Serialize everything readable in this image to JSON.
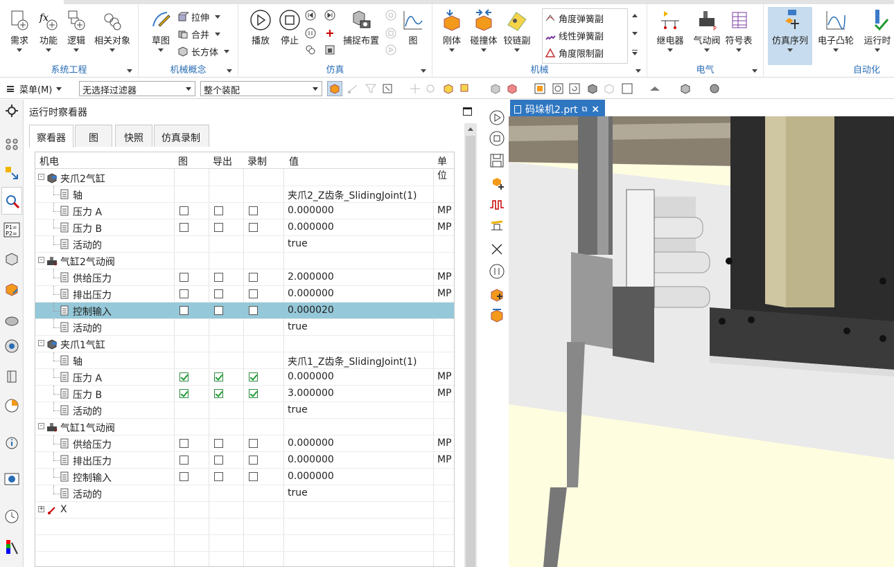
{
  "ribbon": {
    "groups": [
      {
        "label": "系统工程",
        "buttons": [
          "需求",
          "功能",
          "逻辑",
          "相关对象"
        ]
      },
      {
        "label": "机械概念",
        "big": "草图",
        "small": [
          "拉伸",
          "合并",
          "长方体"
        ]
      },
      {
        "label": "仿真",
        "buttons": [
          "播放",
          "停止",
          "捕捉布置",
          "图"
        ]
      },
      {
        "label": "机械",
        "buttons": [
          "刚体",
          "碰撞体",
          "铰链副"
        ],
        "small": [
          "角度弹簧副",
          "线性弹簧副",
          "角度限制副"
        ]
      },
      {
        "label": "电气",
        "buttons": [
          "继电器",
          "气动阀",
          "符号表"
        ]
      },
      {
        "label": "自动化",
        "buttons": [
          "仿真序列",
          "电子凸轮",
          "运行时"
        ]
      }
    ]
  },
  "toolbar2": {
    "menu_label": "菜单(M)",
    "filter_value": "无选择过滤器",
    "scope_value": "整个装配"
  },
  "panel": {
    "title": "运行时察看器",
    "tabs": [
      "察看器",
      "图",
      "快照",
      "仿真录制"
    ],
    "columns": [
      "机电",
      "图",
      "导出",
      "录制",
      "值",
      "单位"
    ],
    "rows": [
      {
        "level": 0,
        "icon": "cylinder-icon",
        "name": "夹爪2气缸",
        "expand": "-",
        "checks": null,
        "value": "",
        "unit": ""
      },
      {
        "level": 1,
        "icon": "param-icon",
        "name": "轴",
        "checks": null,
        "value": "夹爪2_Z齿条_SlidingJoint(1)",
        "unit": ""
      },
      {
        "level": 1,
        "icon": "param-icon",
        "name": "压力 A",
        "checks": [
          false,
          false,
          false
        ],
        "value": "0.000000",
        "unit": "MP"
      },
      {
        "level": 1,
        "icon": "param-icon",
        "name": "压力 B",
        "checks": [
          false,
          false,
          false
        ],
        "value": "0.000000",
        "unit": "MP"
      },
      {
        "level": 1,
        "icon": "param-icon",
        "name": "活动的",
        "checks": null,
        "value": "true",
        "unit": ""
      },
      {
        "level": 0,
        "icon": "valve-icon",
        "name": "气缸2气动阀",
        "expand": "-",
        "checks": null,
        "value": "",
        "unit": ""
      },
      {
        "level": 1,
        "icon": "param-icon",
        "name": "供给压力",
        "checks": [
          false,
          false,
          false
        ],
        "value": "2.000000",
        "unit": "MP"
      },
      {
        "level": 1,
        "icon": "param-icon",
        "name": "排出压力",
        "checks": [
          false,
          false,
          false
        ],
        "value": "0.000000",
        "unit": "MP"
      },
      {
        "level": 1,
        "icon": "param-icon",
        "name": "控制输入",
        "checks": [
          false,
          false,
          false
        ],
        "value": "0.000020",
        "unit": "",
        "selected": true
      },
      {
        "level": 1,
        "icon": "param-icon",
        "name": "活动的",
        "checks": null,
        "value": "true",
        "unit": ""
      },
      {
        "level": 0,
        "icon": "cylinder-icon",
        "name": "夹爪1气缸",
        "expand": "-",
        "checks": null,
        "value": "",
        "unit": ""
      },
      {
        "level": 1,
        "icon": "param-icon",
        "name": "轴",
        "checks": null,
        "value": "夹爪1_Z齿条_SlidingJoint(1)",
        "unit": ""
      },
      {
        "level": 1,
        "icon": "param-icon",
        "name": "压力 A",
        "checks": [
          true,
          true,
          true
        ],
        "value": "0.000000",
        "unit": "MP"
      },
      {
        "level": 1,
        "icon": "param-icon",
        "name": "压力 B",
        "checks": [
          true,
          true,
          true
        ],
        "value": "3.000000",
        "unit": "MP"
      },
      {
        "level": 1,
        "icon": "param-icon",
        "name": "活动的",
        "checks": null,
        "value": "true",
        "unit": ""
      },
      {
        "level": 0,
        "icon": "valve-icon",
        "name": "气缸1气动阀",
        "expand": "-",
        "checks": null,
        "value": "",
        "unit": ""
      },
      {
        "level": 1,
        "icon": "param-icon",
        "name": "供给压力",
        "checks": [
          false,
          false,
          false
        ],
        "value": "0.000000",
        "unit": "MP"
      },
      {
        "level": 1,
        "icon": "param-icon",
        "name": "排出压力",
        "checks": [
          false,
          false,
          false
        ],
        "value": "0.000000",
        "unit": "MP"
      },
      {
        "level": 1,
        "icon": "param-icon",
        "name": "控制输入",
        "checks": [
          false,
          false,
          false
        ],
        "value": "0.000000",
        "unit": ""
      },
      {
        "level": 1,
        "icon": "param-icon",
        "name": "活动的",
        "checks": null,
        "value": "true",
        "unit": ""
      },
      {
        "level": 0,
        "icon": "axis-icon",
        "name": "X",
        "expand": "+",
        "checks": null,
        "value": "",
        "unit": ""
      }
    ]
  },
  "viewport": {
    "tab_label": "码垛机2.prt"
  },
  "colors": {
    "accent": "#2f76c1",
    "selection": "#95c8d8",
    "ribbon_label": "#2a6db5",
    "viewport_bg": "#fffde0"
  }
}
